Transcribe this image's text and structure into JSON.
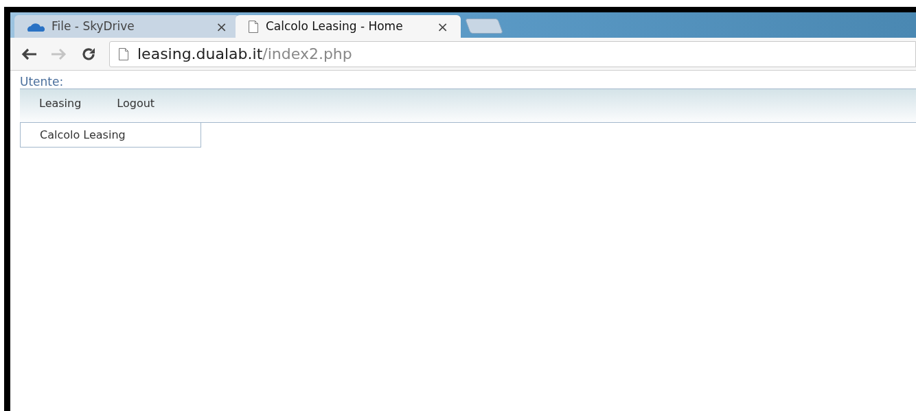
{
  "browser": {
    "tabs": [
      {
        "title": "File - SkyDrive",
        "kind": "cloud",
        "selected": false
      },
      {
        "title": "Calcolo Leasing - Home",
        "kind": "page",
        "selected": true
      }
    ],
    "close_glyph": "×",
    "url_host": "leasing.dualab.it",
    "url_path": "/index2.php"
  },
  "page": {
    "user_label": "Utente:",
    "menu": [
      {
        "label": "Leasing"
      },
      {
        "label": "Logout"
      }
    ],
    "submenu": [
      {
        "label": "Calcolo Leasing"
      }
    ]
  }
}
